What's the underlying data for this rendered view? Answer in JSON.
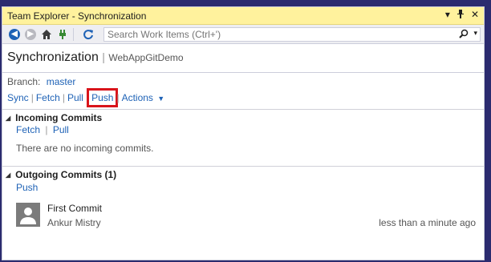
{
  "window": {
    "title": "Team Explorer - Synchronization"
  },
  "toolbar": {
    "search_placeholder": "Search Work Items (Ctrl+')"
  },
  "header": {
    "title": "Synchronization",
    "repo": "WebAppGitDemo"
  },
  "branch": {
    "label": "Branch:",
    "name": "master"
  },
  "actions": {
    "sync": "Sync",
    "fetch": "Fetch",
    "pull": "Pull",
    "push": "Push",
    "actions_menu": "Actions"
  },
  "incoming": {
    "title": "Incoming Commits",
    "fetch": "Fetch",
    "pull": "Pull",
    "message": "There are no incoming commits."
  },
  "outgoing": {
    "title": "Outgoing Commits (1)",
    "push": "Push",
    "commits": [
      {
        "title": "First Commit",
        "author": "Ankur Mistry",
        "time": "less than a minute ago"
      }
    ]
  },
  "colors": {
    "titlebar_bg": "#fff29d",
    "link": "#1e62b6",
    "highlight": "#d9141b"
  }
}
